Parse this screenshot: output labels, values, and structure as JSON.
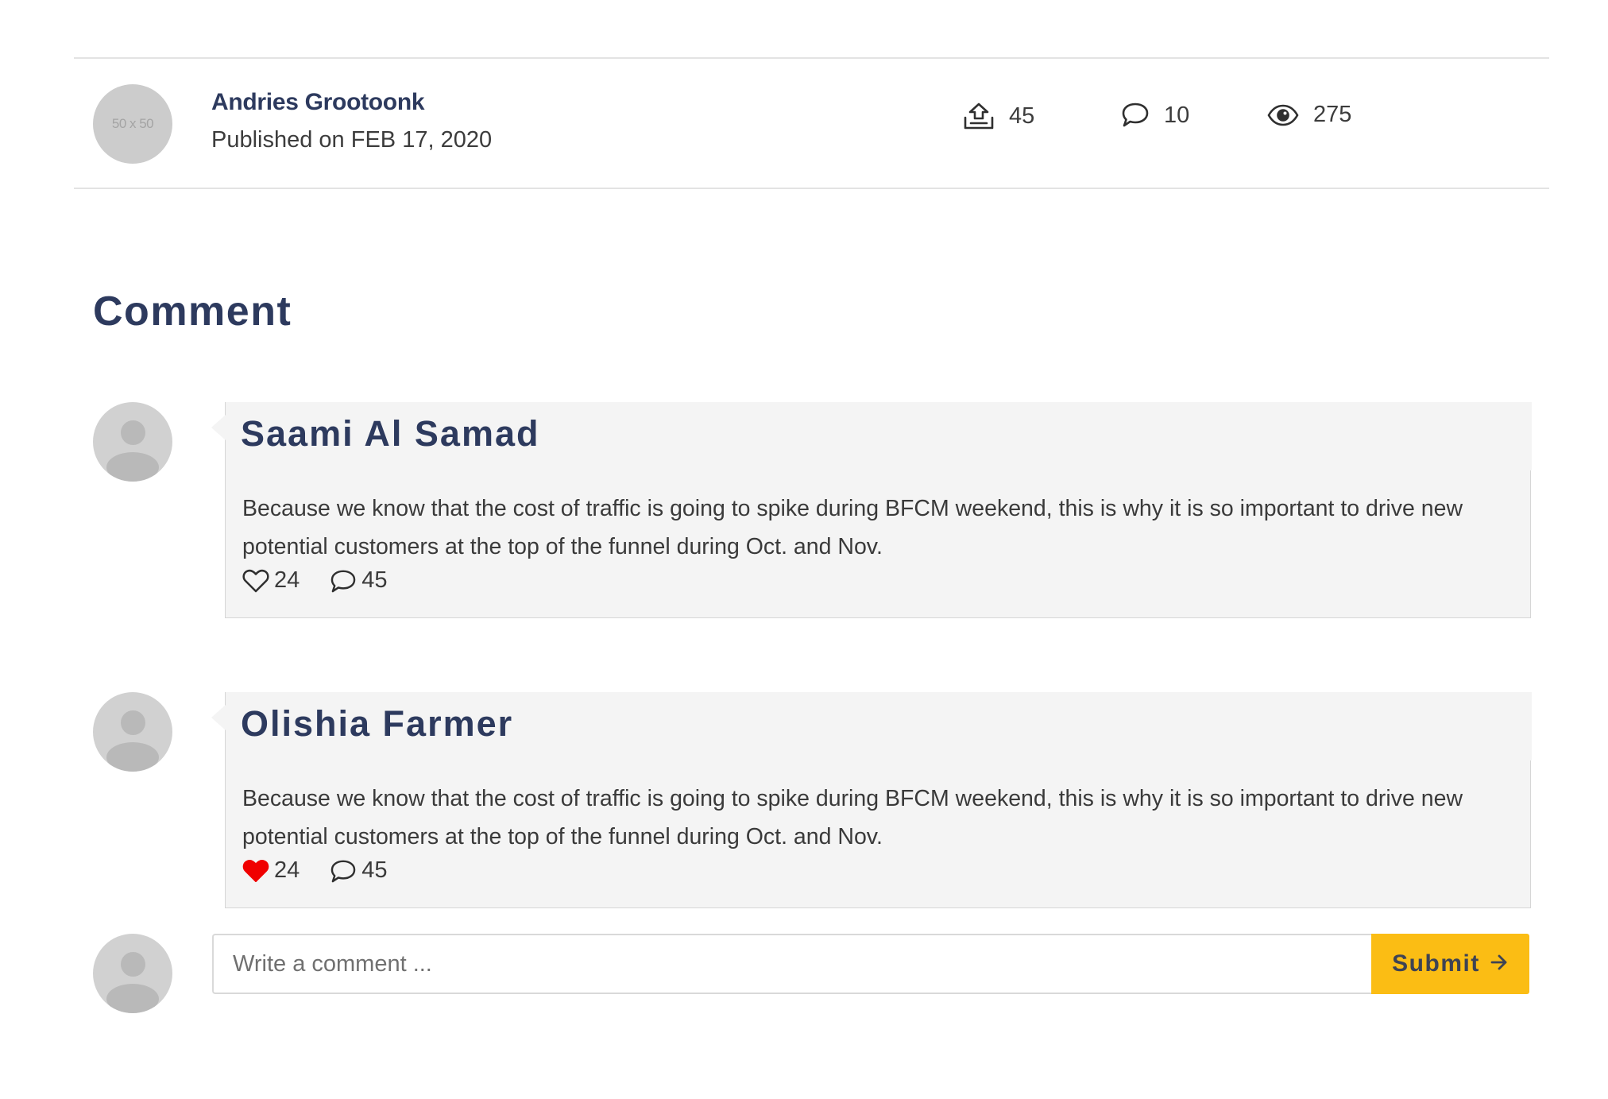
{
  "post": {
    "author_avatar_text": "50 x 50",
    "author_name": "Andries Grootoonk",
    "published": "Published on FEB 17, 2020",
    "stats": {
      "shares": "45",
      "comments": "10",
      "views": "275"
    }
  },
  "comments_section": {
    "heading": "Comment",
    "comments": [
      {
        "author": "Saami Al Samad",
        "text": "Because we know that the cost of traffic is going to spike during BFCM weekend, this is why it is so important to drive new potential customers at the top of the funnel during Oct. and Nov.",
        "likes": "24",
        "replies": "45",
        "liked": false
      },
      {
        "author": "Olishia Farmer",
        "text": "Because we know that the cost of traffic is going to spike during BFCM weekend, this is why it is so important to drive new potential customers at the top of the funnel during Oct. and Nov.",
        "likes": "24",
        "replies": "45",
        "liked": true
      }
    ]
  },
  "form": {
    "placeholder": "Write a comment ...",
    "submit_label": "Submit"
  },
  "colors": {
    "heading": "#2d3a5e",
    "accent": "#fbbd14",
    "liked_heart": "#f00000",
    "card_bg": "#f4f4f4"
  },
  "icons": {
    "shares": "share-upload-icon",
    "comments": "comment-bubble-icon",
    "views": "eye-icon",
    "like": "heart-icon",
    "submit": "arrow-right-icon"
  }
}
